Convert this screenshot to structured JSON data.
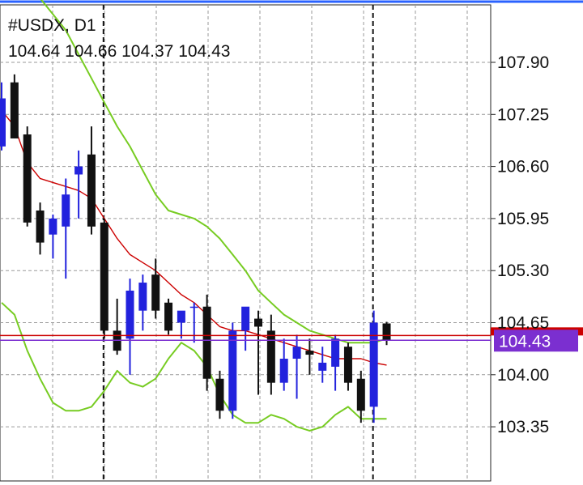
{
  "header": {
    "symbol_line": "#USDX, D1",
    "ohlc_line": "104.64 104.66 104.37 104.43"
  },
  "price_badge": {
    "label": "104.43",
    "color": "#7b2fd0"
  },
  "colors": {
    "bull": "#2222dd",
    "bear": "#111111",
    "bands": "#77cc22",
    "middle_line": "#cc0000",
    "price_line": "#7b2fd0",
    "top_marker": "#2a62ff",
    "grid": "#9a9a9a"
  },
  "chart_data": {
    "type": "candlestick",
    "title": "#USDX, D1",
    "y_axis": {
      "ticks": [
        "107.90",
        "107.25",
        "106.60",
        "105.95",
        "105.30",
        "104.65",
        "104.00",
        "103.35"
      ],
      "range": [
        103.0,
        108.6
      ],
      "position": "right"
    },
    "grid": true,
    "period_separators": 2,
    "current_price": 104.43,
    "red_level": 104.49,
    "candles": [
      {
        "o": 106.85,
        "h": 107.65,
        "l": 106.8,
        "c": 107.45
      },
      {
        "o": 107.65,
        "h": 107.75,
        "l": 106.95,
        "c": 106.95
      },
      {
        "o": 107.0,
        "h": 107.1,
        "l": 105.85,
        "c": 105.9
      },
      {
        "o": 106.05,
        "h": 106.15,
        "l": 105.5,
        "c": 105.65
      },
      {
        "o": 105.75,
        "h": 106.0,
        "l": 105.45,
        "c": 105.95
      },
      {
        "o": 105.85,
        "h": 106.45,
        "l": 105.2,
        "c": 106.25
      },
      {
        "o": 106.5,
        "h": 106.8,
        "l": 105.95,
        "c": 106.6
      },
      {
        "o": 106.75,
        "h": 107.1,
        "l": 105.75,
        "c": 105.85
      },
      {
        "o": 105.9,
        "h": 105.95,
        "l": 104.45,
        "c": 104.55
      },
      {
        "o": 104.55,
        "h": 104.95,
        "l": 104.25,
        "c": 104.3
      },
      {
        "o": 104.45,
        "h": 105.2,
        "l": 104.0,
        "c": 105.05
      },
      {
        "o": 104.8,
        "h": 105.25,
        "l": 104.55,
        "c": 105.15
      },
      {
        "o": 105.25,
        "h": 105.45,
        "l": 104.7,
        "c": 104.8
      },
      {
        "o": 104.9,
        "h": 104.95,
        "l": 104.5,
        "c": 104.55
      },
      {
        "o": 104.65,
        "h": 104.75,
        "l": 104.45,
        "c": 104.8
      },
      {
        "o": 104.85,
        "h": 104.9,
        "l": 104.4,
        "c": 104.85
      },
      {
        "o": 104.85,
        "h": 105.0,
        "l": 103.8,
        "c": 103.95
      },
      {
        "o": 103.95,
        "h": 104.05,
        "l": 103.45,
        "c": 103.55
      },
      {
        "o": 103.55,
        "h": 104.65,
        "l": 103.45,
        "c": 104.55
      },
      {
        "o": 104.55,
        "h": 104.8,
        "l": 104.3,
        "c": 104.85
      },
      {
        "o": 104.7,
        "h": 104.8,
        "l": 103.75,
        "c": 104.6
      },
      {
        "o": 104.55,
        "h": 104.75,
        "l": 103.75,
        "c": 103.9
      },
      {
        "o": 103.9,
        "h": 104.45,
        "l": 103.8,
        "c": 104.2
      },
      {
        "o": 104.2,
        "h": 104.5,
        "l": 103.7,
        "c": 104.35
      },
      {
        "o": 104.3,
        "h": 104.45,
        "l": 104.0,
        "c": 104.25
      },
      {
        "o": 104.05,
        "h": 104.35,
        "l": 103.9,
        "c": 104.15
      },
      {
        "o": 104.1,
        "h": 104.5,
        "l": 103.8,
        "c": 104.45
      },
      {
        "o": 104.35,
        "h": 104.4,
        "l": 103.8,
        "c": 103.9
      },
      {
        "o": 103.95,
        "h": 104.05,
        "l": 103.4,
        "c": 103.55
      },
      {
        "o": 103.6,
        "h": 104.8,
        "l": 103.4,
        "c": 104.65
      },
      {
        "o": 104.64,
        "h": 104.66,
        "l": 104.37,
        "c": 104.43
      }
    ],
    "bands": {
      "upper": [
        109.7,
        109.4,
        109.0,
        108.7,
        108.5,
        108.3,
        108.0,
        107.7,
        107.4,
        107.1,
        106.85,
        106.55,
        106.25,
        106.05,
        106.0,
        105.95,
        105.85,
        105.7,
        105.5,
        105.3,
        105.05,
        104.9,
        104.75,
        104.65,
        104.55,
        104.5,
        104.45,
        104.4,
        104.4,
        104.4,
        104.45
      ],
      "middle": [
        107.3,
        107.1,
        106.65,
        106.45,
        106.4,
        106.35,
        106.3,
        106.2,
        105.95,
        105.7,
        105.5,
        105.4,
        105.3,
        105.15,
        105.0,
        104.9,
        104.75,
        104.6,
        104.55,
        104.55,
        104.5,
        104.45,
        104.4,
        104.35,
        104.3,
        104.25,
        104.2,
        104.2,
        104.2,
        104.15,
        104.12
      ],
      "lower": [
        104.9,
        104.75,
        104.3,
        103.95,
        103.65,
        103.55,
        103.55,
        103.6,
        103.8,
        104.05,
        103.9,
        103.85,
        103.95,
        104.2,
        104.4,
        104.3,
        104.1,
        103.75,
        103.5,
        103.4,
        103.4,
        103.5,
        103.45,
        103.35,
        103.3,
        103.35,
        103.5,
        103.6,
        103.45,
        103.45,
        103.45
      ]
    }
  }
}
